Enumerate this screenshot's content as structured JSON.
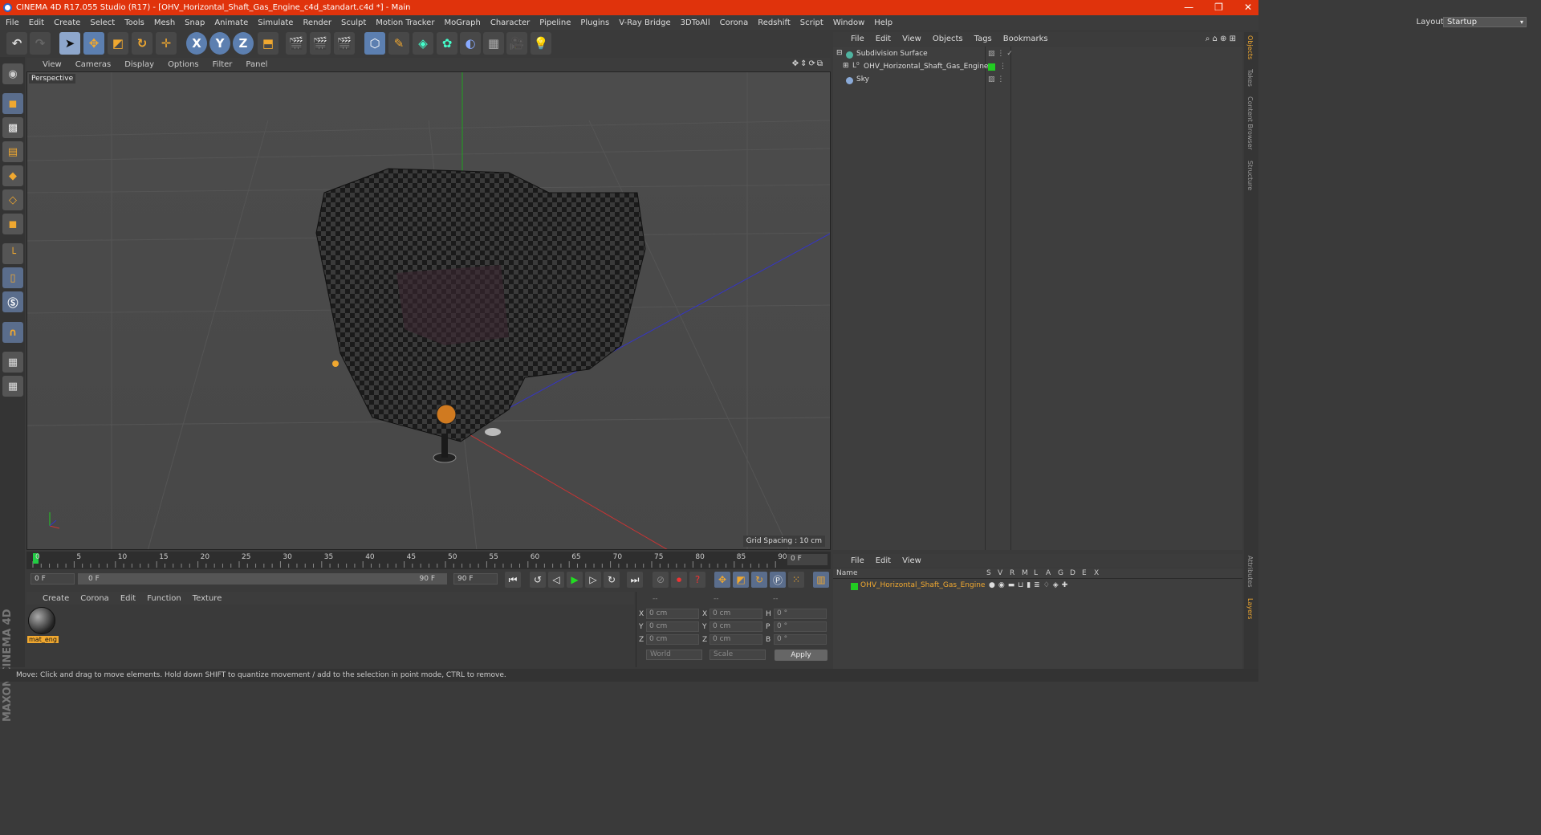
{
  "window": {
    "title": "CINEMA 4D R17.055 Studio (R17) - [OHV_Horizontal_Shaft_Gas_Engine_c4d_standart.c4d *] - Main",
    "controls": [
      "—",
      "❐",
      "✕"
    ]
  },
  "menubar": {
    "items": [
      "File",
      "Edit",
      "Create",
      "Select",
      "Tools",
      "Mesh",
      "Snap",
      "Animate",
      "Simulate",
      "Render",
      "Sculpt",
      "Motion Tracker",
      "MoGraph",
      "Character",
      "Pipeline",
      "Plugins",
      "V-Ray Bridge",
      "3DToAll",
      "Corona",
      "Redshift",
      "Script",
      "Window",
      "Help"
    ],
    "layout_label": "Layout:",
    "layout_value": "Startup"
  },
  "toolbar": {
    "axis_x": "X",
    "axis_y": "Y",
    "axis_z": "Z"
  },
  "viewport": {
    "menu": [
      "View",
      "Cameras",
      "Display",
      "Options",
      "Filter",
      "Panel"
    ],
    "label": "Perspective",
    "grid_spacing": "Grid Spacing : 10 cm"
  },
  "timeline": {
    "ticks": [
      "0",
      "5",
      "10",
      "15",
      "20",
      "25",
      "30",
      "35",
      "40",
      "45",
      "50",
      "55",
      "60",
      "65",
      "70",
      "75",
      "80",
      "85",
      "90"
    ],
    "current_frame": "0 F"
  },
  "transport": {
    "start_frame": "0 F",
    "range_start": "0 F",
    "range_end": "90 F",
    "end_frame": "90 F"
  },
  "material_manager": {
    "menu": [
      "Create",
      "Corona",
      "Edit",
      "Function",
      "Texture"
    ],
    "material_name": "mat_eng"
  },
  "coordinates": {
    "headers": [
      "--",
      "--",
      "--"
    ],
    "rows": [
      {
        "l1": "X",
        "v1": "0 cm",
        "l2": "X",
        "v2": "0 cm",
        "l3": "H",
        "v3": "0 °"
      },
      {
        "l1": "Y",
        "v1": "0 cm",
        "l2": "Y",
        "v2": "0 cm",
        "l3": "P",
        "v3": "0 °"
      },
      {
        "l1": "Z",
        "v1": "0 cm",
        "l2": "Z",
        "v2": "0 cm",
        "l3": "B",
        "v3": "0 °"
      }
    ],
    "space": "World",
    "mode": "Scale",
    "apply": "Apply"
  },
  "object_manager": {
    "menu": [
      "File",
      "Edit",
      "View",
      "Objects",
      "Tags",
      "Bookmarks"
    ],
    "objects": [
      {
        "name": "Subdivision Surface",
        "color": "#4fb3a0"
      },
      {
        "name": "OHV_Horizontal_Shaft_Gas_Engine",
        "color": "#aab"
      },
      {
        "name": "Sky",
        "color": "#8aaad8"
      }
    ]
  },
  "layer_manager": {
    "menu": [
      "File",
      "Edit",
      "View"
    ],
    "col_name": "Name",
    "col_flags": [
      "S",
      "V",
      "R",
      "M",
      "L",
      "A",
      "G",
      "D",
      "E",
      "X"
    ],
    "layer_name": "OHV_Horizontal_Shaft_Gas_Engine",
    "layer_color": "#22cc22"
  },
  "right_tabs": [
    "Objects",
    "Takes",
    "Content Browser",
    "Structure",
    "Attributes",
    "Layers"
  ],
  "branding": "MAXON CINEMA 4D",
  "status": "Move: Click and drag to move elements. Hold down SHIFT to quantize movement / add to the selection in point mode, CTRL to remove."
}
